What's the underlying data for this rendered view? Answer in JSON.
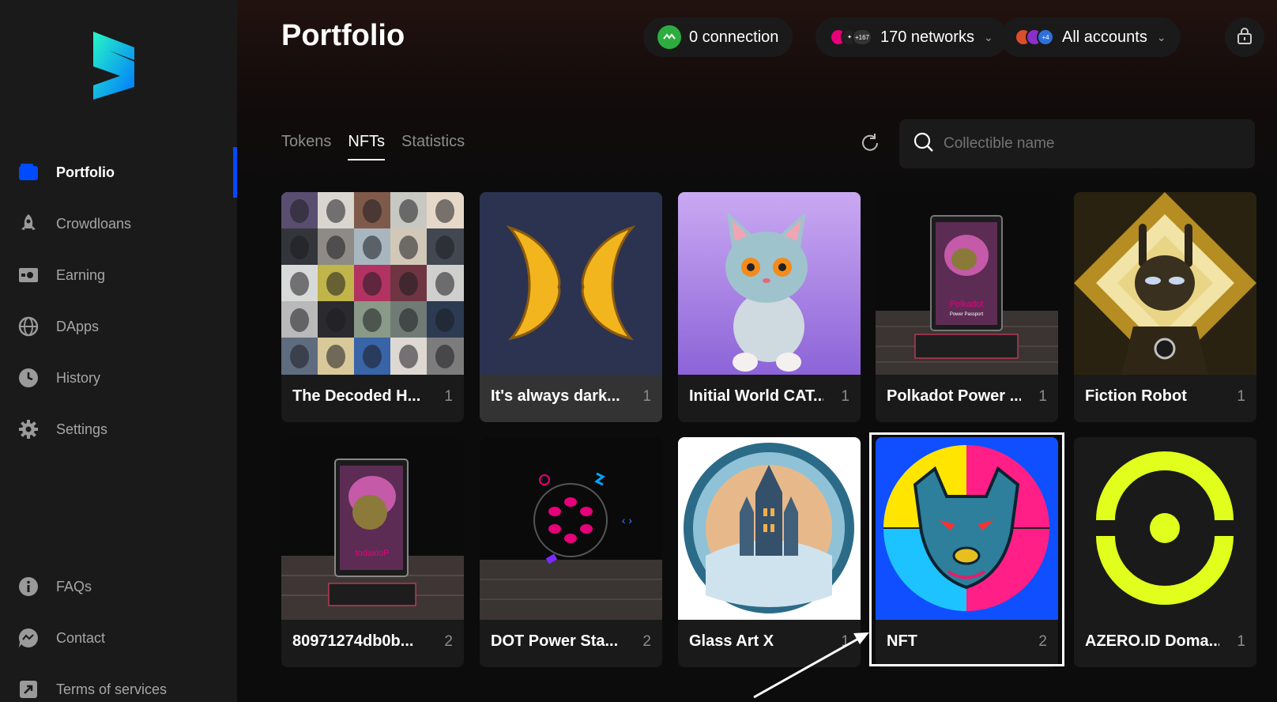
{
  "sidebar": {
    "items": [
      {
        "label": "Portfolio",
        "icon": "wallet-icon"
      },
      {
        "label": "Crowdloans",
        "icon": "rocket-icon"
      },
      {
        "label": "Earning",
        "icon": "earning-icon"
      },
      {
        "label": "DApps",
        "icon": "globe-icon"
      },
      {
        "label": "History",
        "icon": "clock-icon"
      },
      {
        "label": "Settings",
        "icon": "gear-icon"
      }
    ],
    "bottom_items": [
      {
        "label": "FAQs",
        "icon": "info-icon"
      },
      {
        "label": "Contact",
        "icon": "chat-icon"
      },
      {
        "label": "Terms of services",
        "icon": "external-link-icon"
      }
    ]
  },
  "header": {
    "title": "Portfolio",
    "connection_label": "0 connection",
    "networks_label": "170 networks",
    "networks_badge": "+167",
    "accounts_label": "All accounts",
    "accounts_badge": "+4"
  },
  "tabs": [
    "Tokens",
    "NFTs",
    "Statistics"
  ],
  "active_tab": "NFTs",
  "search": {
    "placeholder": "Collectible name"
  },
  "collections": [
    {
      "name": "The Decoded H...",
      "count": "1"
    },
    {
      "name": "It's always dark...",
      "count": "1"
    },
    {
      "name": "Initial World CAT...",
      "count": "1"
    },
    {
      "name": "Polkadot Power ...",
      "count": "1"
    },
    {
      "name": "Fiction Robot",
      "count": "1"
    },
    {
      "name": "80971274db0b...",
      "count": "2"
    },
    {
      "name": "DOT Power Sta...",
      "count": "2"
    },
    {
      "name": "Glass Art X",
      "count": "1"
    },
    {
      "name": "NFT",
      "count": "2"
    },
    {
      "name": "AZERO.ID Doma...",
      "count": "1"
    }
  ],
  "colors": {
    "accent": "#004bff",
    "connection": "#2dad40",
    "azero": "#e1ff1c"
  }
}
